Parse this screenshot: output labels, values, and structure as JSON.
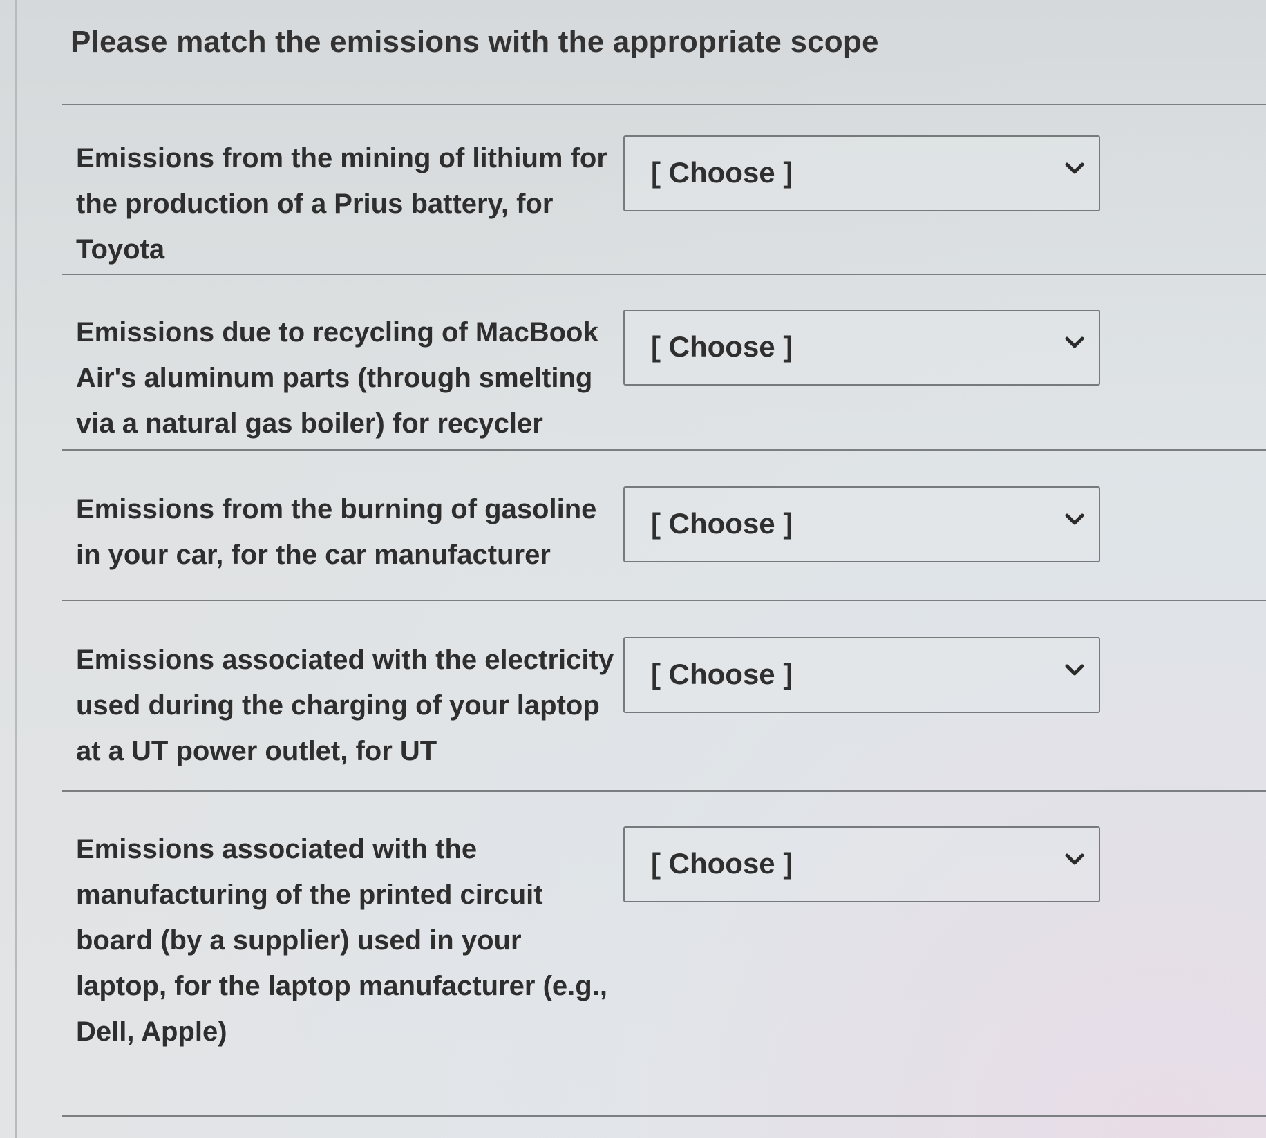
{
  "question": {
    "title": "Please match the emissions with the appropriate scope"
  },
  "items": [
    {
      "label": "Emissions from the mining of lithium for the production of a Prius battery, for Toyota",
      "select": {
        "value": "[ Choose ]",
        "icon": "chevron-down-icon"
      }
    },
    {
      "label": "Emissions due to recycling of MacBook Air's aluminum parts (through smelting via a natural gas boiler) for recycler",
      "select": {
        "value": "[ Choose ]",
        "icon": "chevron-down-icon"
      }
    },
    {
      "label": "Emissions from the burning of gasoline in your car, for the car manufacturer",
      "select": {
        "value": "[ Choose ]",
        "icon": "chevron-down-icon"
      }
    },
    {
      "label": "Emissions associated with the electricity used during the charging of your laptop at a UT power outlet, for UT",
      "select": {
        "value": "[ Choose ]",
        "icon": "chevron-down-icon"
      }
    },
    {
      "label": "Emissions associated with the manufacturing of the printed circuit board (by a supplier) used in your laptop, for the laptop manufacturer (e.g., Dell, Apple)",
      "select": {
        "value": "[ Choose ]",
        "icon": "chevron-down-icon"
      }
    }
  ]
}
